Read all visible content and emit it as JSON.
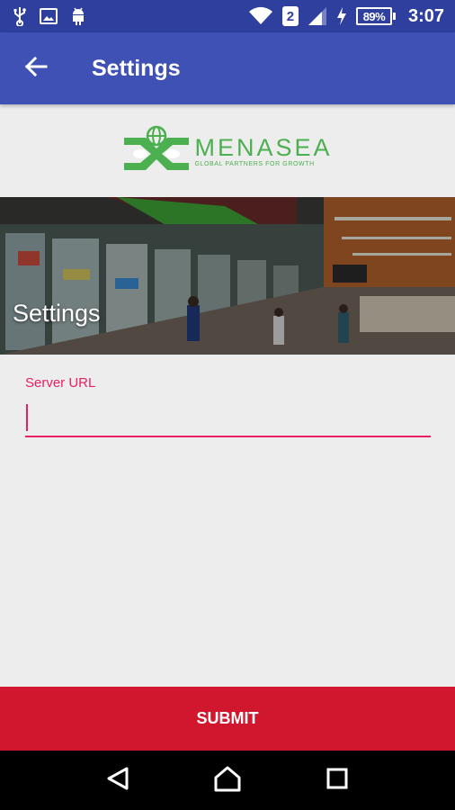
{
  "status_bar": {
    "left_icons": [
      "usb-icon",
      "image-icon",
      "android-icon"
    ],
    "sim_label": "2",
    "battery_percent": "89%",
    "time": "3:07"
  },
  "app_bar": {
    "title": "Settings",
    "back_icon": "arrow-left-icon"
  },
  "logo": {
    "name": "MENASEA",
    "tagline": "GLOBAL PARTNERS FOR GROWTH",
    "color": "#4caf50"
  },
  "banner": {
    "title": "Settings"
  },
  "form": {
    "server_url_label": "Server URL",
    "server_url_value": ""
  },
  "submit": {
    "label": "SUBMIT",
    "color": "#d1172e"
  },
  "nav_bar": {
    "items": [
      "back-triangle-icon",
      "home-icon",
      "recents-icon"
    ]
  },
  "colors": {
    "primary": "#3f51b5",
    "primary_dark": "#2f3f9e",
    "accent": "#e91e63"
  }
}
